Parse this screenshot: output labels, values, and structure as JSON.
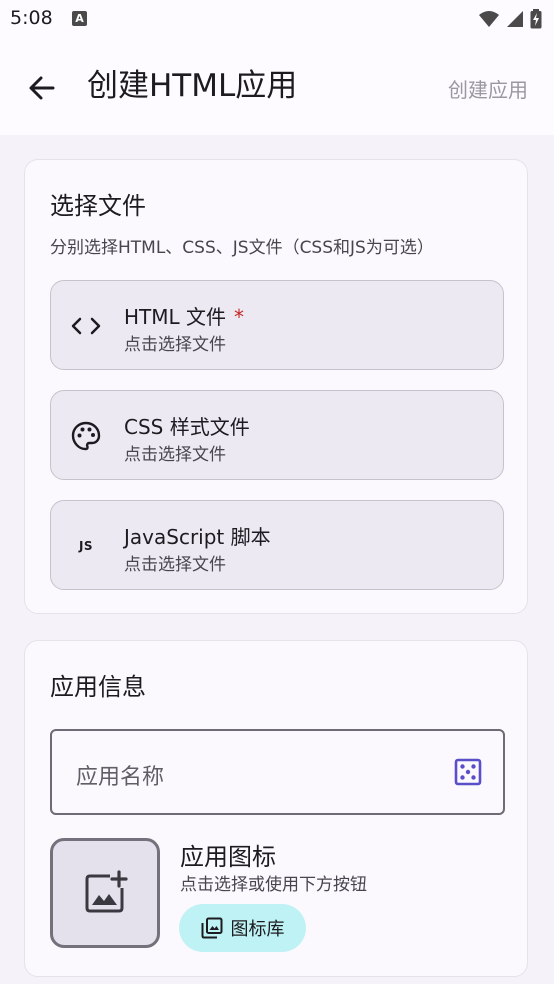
{
  "status_bar": {
    "time": "5:08",
    "notification_badge": "A"
  },
  "app_bar": {
    "title": "创建HTML应用",
    "action_label": "创建应用"
  },
  "select_files": {
    "title": "选择文件",
    "subtitle": "分别选择HTML、CSS、JS文件（CSS和JS为可选）",
    "items": [
      {
        "title": "HTML 文件",
        "required_mark": "*",
        "subtitle": "点击选择文件",
        "icon": "code-icon"
      },
      {
        "title": "CSS 样式文件",
        "subtitle": "点击选择文件",
        "icon": "palette-icon"
      },
      {
        "title": "JavaScript 脚本",
        "subtitle": "点击选择文件",
        "icon": "js-icon",
        "icon_text": "JS"
      }
    ]
  },
  "app_info": {
    "title": "应用信息",
    "name_placeholder": "应用名称",
    "icon_title": "应用图标",
    "icon_subtitle": "点击选择或使用下方按钮",
    "icon_library_label": "图标库"
  },
  "colors": {
    "accent": "#6750a4",
    "dice": "#5b4fc9",
    "icon_library_bg": "#bff2f4"
  }
}
